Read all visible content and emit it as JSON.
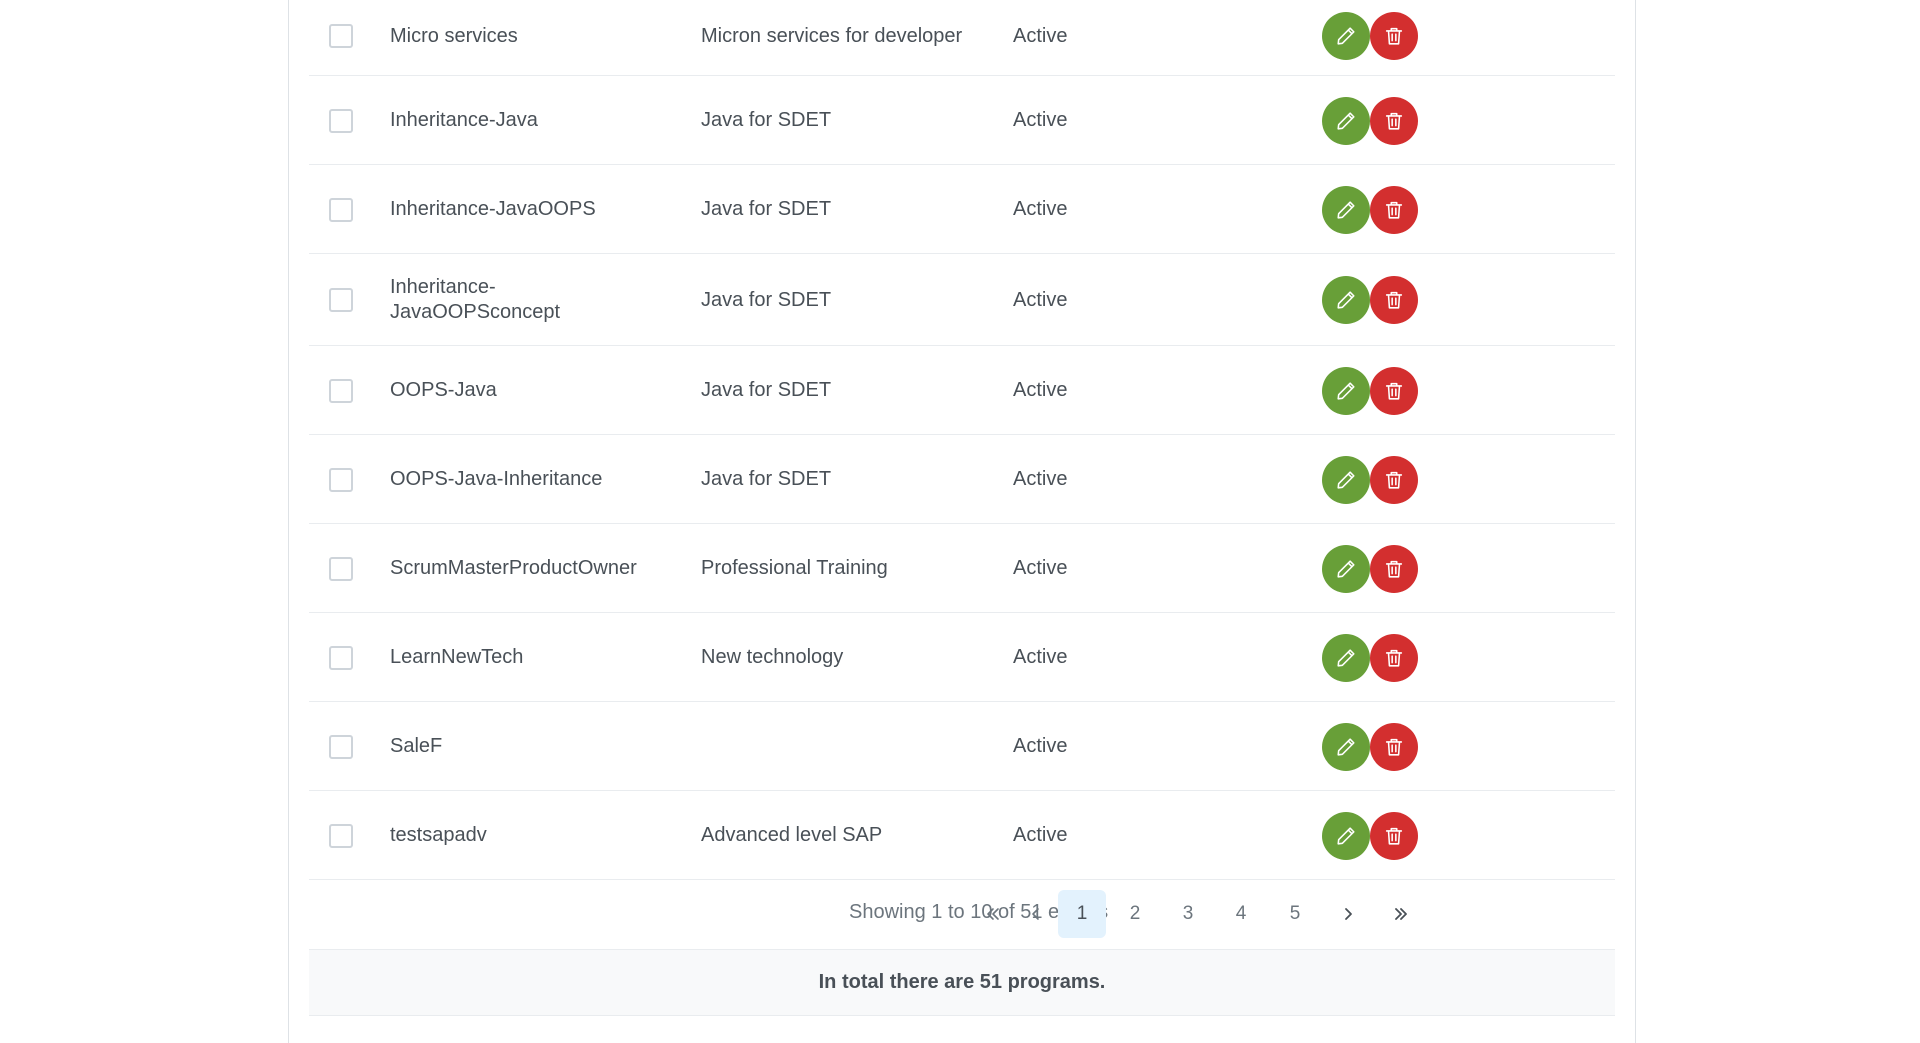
{
  "rows": [
    {
      "name": "Micro services",
      "description": "Micron services for developer",
      "status": "Active"
    },
    {
      "name": "Inheritance-Java",
      "description": "Java for SDET",
      "status": "Active"
    },
    {
      "name": "Inheritance-JavaOOPS",
      "description": "Java for SDET",
      "status": "Active"
    },
    {
      "name": "Inheritance-\nJavaOOPSconcept",
      "description": "Java for SDET",
      "status": "Active"
    },
    {
      "name": "OOPS-Java",
      "description": "Java for SDET",
      "status": "Active"
    },
    {
      "name": "OOPS-Java-Inheritance",
      "description": "Java for SDET",
      "status": "Active"
    },
    {
      "name": "ScrumMasterProductOwner",
      "description": "Professional Training",
      "status": "Active"
    },
    {
      "name": "LearnNewTech",
      "description": "New technology",
      "status": "Active"
    },
    {
      "name": "SaleF",
      "description": "",
      "status": "Active"
    },
    {
      "name": "testsapadv",
      "description": "Advanced level SAP",
      "status": "Active"
    }
  ],
  "actions": {
    "edit_icon": "pencil-icon",
    "delete_icon": "trash-icon"
  },
  "paginator": {
    "info": "Showing 1 to 10 of 51 entries",
    "pages": [
      "1",
      "2",
      "3",
      "4",
      "5"
    ],
    "current_page": "1"
  },
  "footer": {
    "text": "In total there are 51 programs."
  },
  "colors": {
    "edit": "#689f38",
    "delete": "#d32f2f",
    "active_page": "#e3f2fd"
  }
}
